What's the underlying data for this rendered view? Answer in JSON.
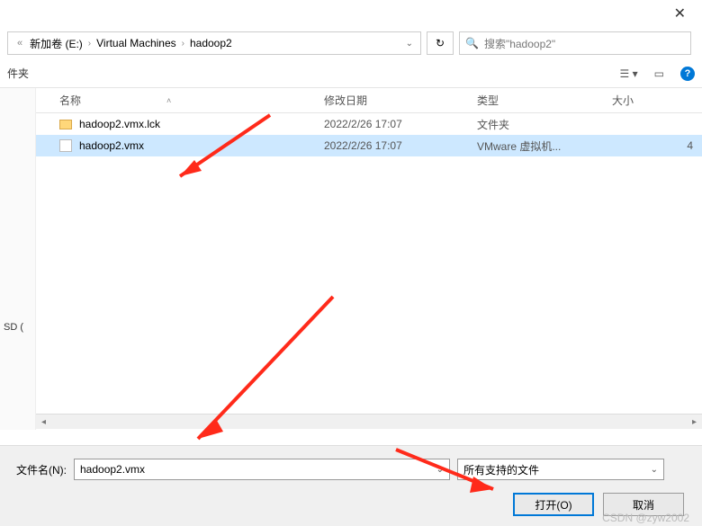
{
  "breadcrumb": {
    "seg1": "新加卷 (E:)",
    "seg2": "Virtual Machines",
    "seg3": "hadoop2"
  },
  "search": {
    "placeholder": "搜索\"hadoop2\""
  },
  "toolbar": {
    "left": "件夹"
  },
  "columns": {
    "name": "名称",
    "date": "修改日期",
    "type": "类型",
    "size": "大小"
  },
  "rows": [
    {
      "name": "hadoop2.vmx.lck",
      "date": "2022/2/26 17:07",
      "type": "文件夹",
      "size": "",
      "icon": "folder",
      "selected": false
    },
    {
      "name": "hadoop2.vmx",
      "date": "2022/2/26 17:07",
      "type": "VMware 虚拟机...",
      "size": "4",
      "icon": "file",
      "selected": true
    }
  ],
  "sidebar": {
    "label": "SD ("
  },
  "bottom": {
    "filename_label": "文件名(N):",
    "filename_value": "hadoop2.vmx",
    "filter": "所有支持的文件",
    "open": "打开(O)",
    "cancel": "取消"
  },
  "watermark": "CSDN @zyw2002"
}
